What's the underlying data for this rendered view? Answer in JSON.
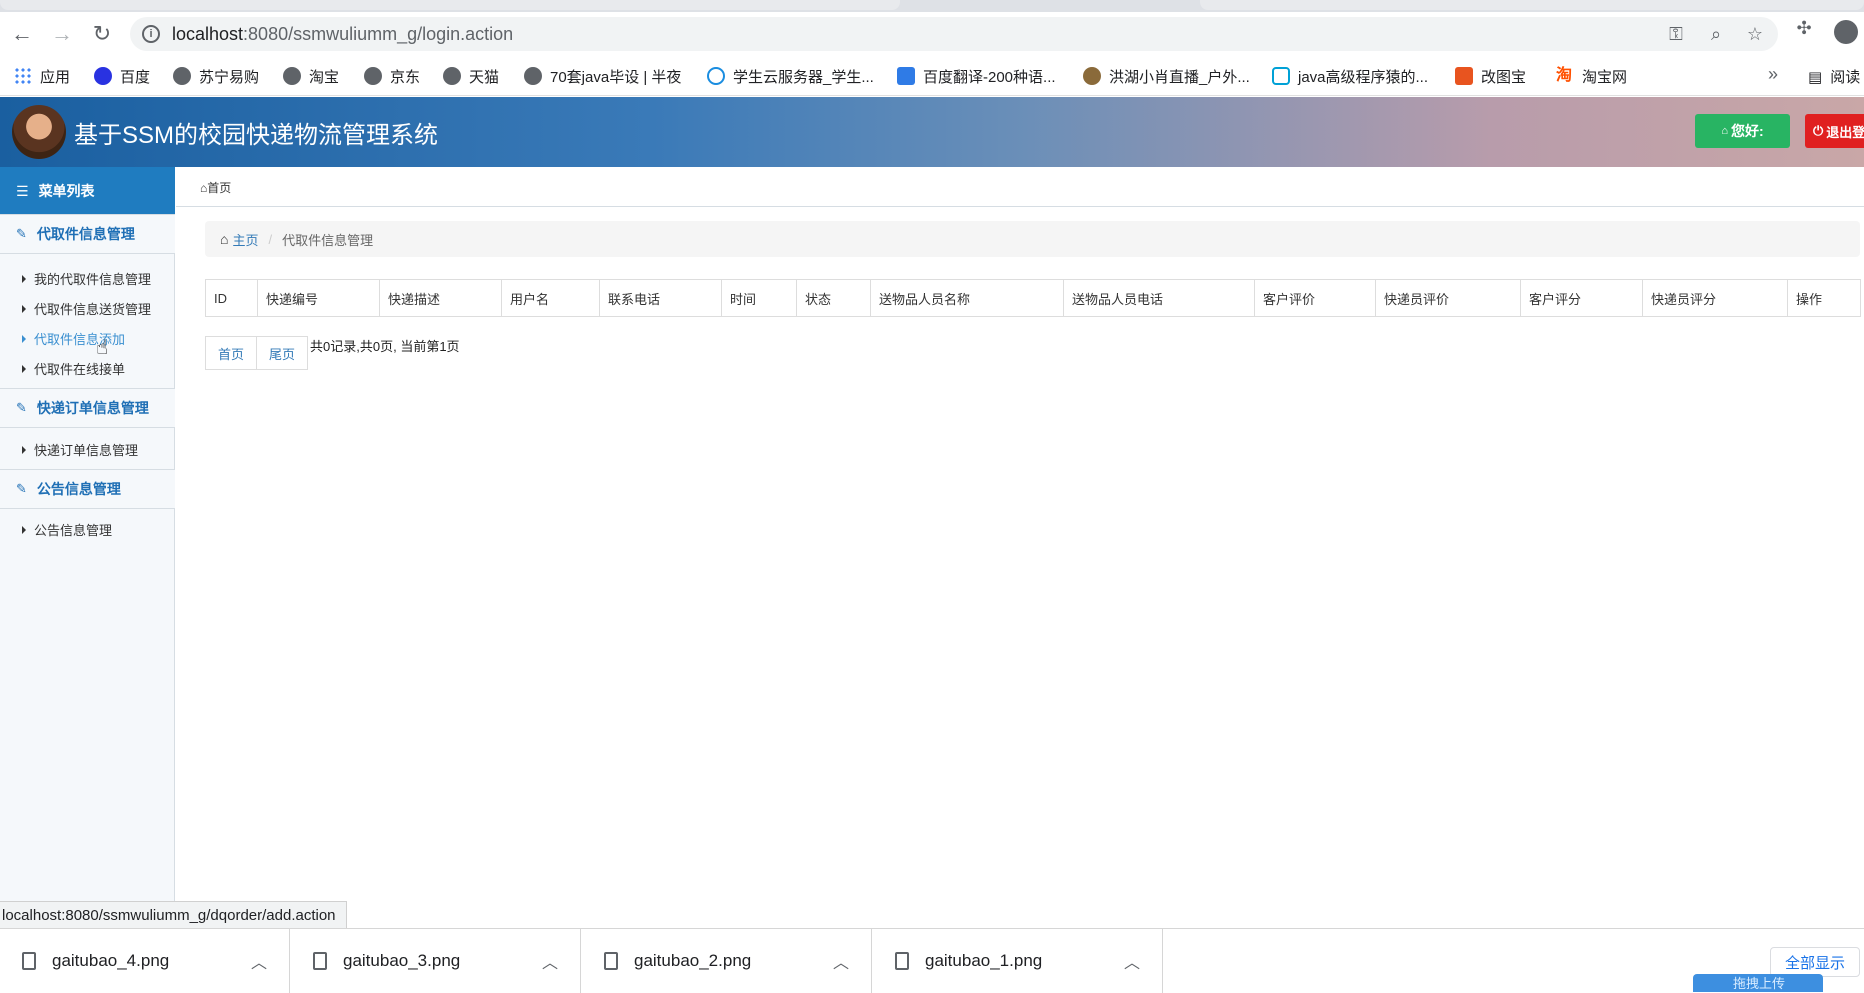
{
  "browser": {
    "url_host": "localhost",
    "url_rest": ":8080/ssmwuliumm_g/login.action",
    "icons": [
      "back-icon",
      "forward-icon",
      "reload-icon",
      "info-icon",
      "key-icon",
      "zoom-icon",
      "star-icon",
      "puzzle-icon",
      "profile-icon"
    ],
    "bookmarks": [
      "应用",
      "百度",
      "苏宁易购",
      "淘宝",
      "京东",
      "天猫",
      "70套java毕设 | 半夜",
      "学生云服务器_学生...",
      "百度翻译-200种语...",
      "洪湖小肖直播_户外...",
      "java高级程序猿的...",
      "改图宝",
      "淘宝网"
    ],
    "more": "»",
    "reading_list": "阅读"
  },
  "header": {
    "title": "基于SSM的校园快递物流管理系统",
    "hello": "您好:",
    "logout": "退出登"
  },
  "sidebar": {
    "menu_title": "菜单列表",
    "groups": [
      {
        "label": "代取件信息管理",
        "items": [
          "我的代取件信息管理",
          "代取件信息送货管理",
          "代取件信息添加",
          "代取件在线接单"
        ]
      },
      {
        "label": "快递订单信息管理",
        "items": [
          "快递订单信息管理"
        ]
      },
      {
        "label": "公告信息管理",
        "items": [
          "公告信息管理"
        ]
      }
    ]
  },
  "main": {
    "top_crumb": "首页",
    "breadcrumb": {
      "home": "主页",
      "current": "代取件信息管理"
    },
    "table": {
      "columns": [
        "ID",
        "快递编号",
        "快递描述",
        "用户名",
        "联系电话",
        "时间",
        "状态",
        "送物品人员名称",
        "送物品人员电话",
        "客户评价",
        "快递员评价",
        "客户评分",
        "快递员评分",
        "操作"
      ],
      "rows": []
    },
    "pager": {
      "first": "首页",
      "last": "尾页",
      "info": "共0记录,共0页, 当前第1页"
    }
  },
  "status": {
    "link_url": "localhost:8080/ssmwuliumm_g/dqorder/add.action"
  },
  "downloads": {
    "files": [
      "gaitubao_4.png",
      "gaitubao_3.png",
      "gaitubao_2.png",
      "gaitubao_1.png"
    ],
    "show_all": "全部显示",
    "upload_widget": "拖拽上传"
  }
}
